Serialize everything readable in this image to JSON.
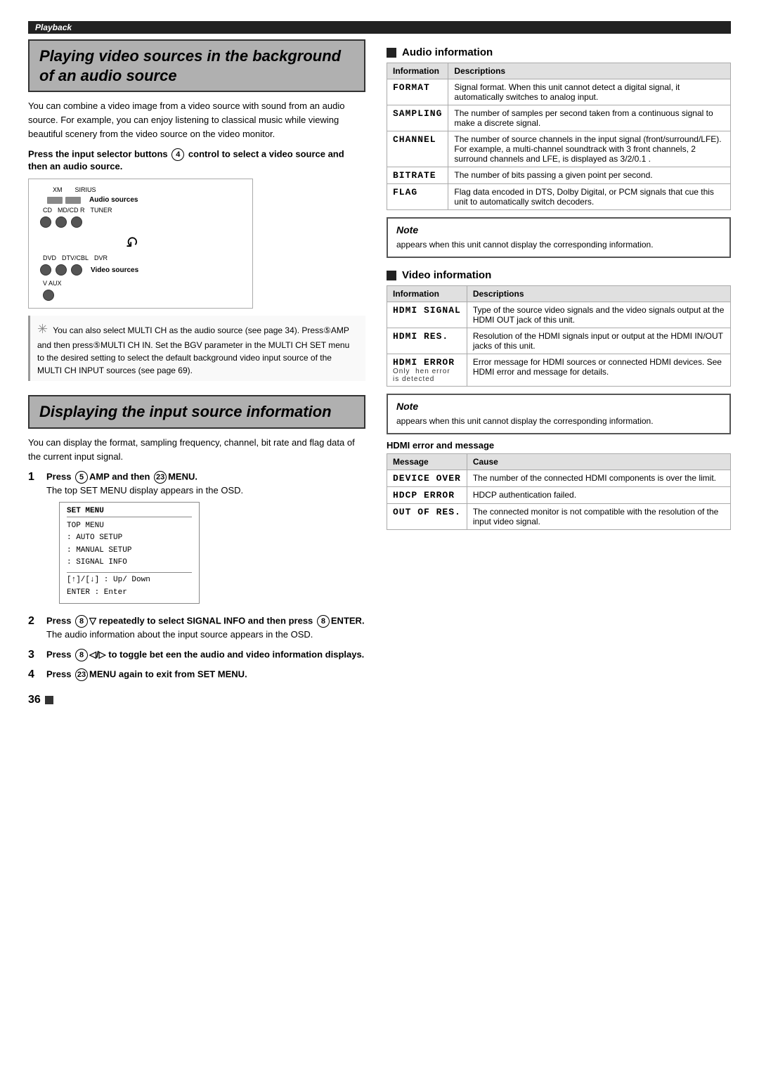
{
  "page": {
    "playback_label": "Playback",
    "page_number": "36"
  },
  "left": {
    "section1": {
      "title": "Playing video sources in the background of an audio source",
      "body": "You can combine a video image from a video source with sound from an audio source. For example, you can enjoy listening to classical music while viewing beautiful scenery from the video source on the video monitor.",
      "instruction_bold": "Press the input selector buttons",
      "circle4": "4",
      "instruction_rest": " control to select a video source and then an audio source.",
      "diagram": {
        "audio_label": "Audio sources",
        "video_label": "Video sources",
        "xm_label": "XM",
        "sirius_label": "SIRIUS",
        "cd_label": "CD",
        "mdcd_label": "MD/CD R",
        "tuner_label": "TUNER",
        "dvd_label": "DVD",
        "dtvcbl_label": "DTV/CBL",
        "dvr_label": "DVR",
        "vaux_label": "V AUX"
      },
      "tip": "You can also select MULTI CH as the audio source (see page 34). Press⑤AMP and then press⑤MULTI CH IN. Set the BGV parameter in the MULTI CH SET menu to the desired setting to select the default background video input source of the MULTI CH INPUT sources (see page 69)."
    },
    "section2": {
      "title": "Displaying the input source information",
      "body": "You can display the format, sampling frequency, channel, bit rate and flag data of the current input signal.",
      "steps": [
        {
          "num": "1",
          "bold": "Press ⑤AMP and then ㉓MENU.",
          "body": "The top SET MENU display appears in the OSD.",
          "osd": {
            "title": "SET MENU",
            "lines": [
              "TOP MENU",
              ": AUTO SETUP",
              ": MANUAL SETUP",
              ": SIGNAL INFO",
              "[↑]/[↓] : Up/ Down",
              "ENTER : Enter"
            ]
          }
        },
        {
          "num": "2",
          "bold": "Press ⑧▽ repeatedly to select SIGNAL INFO and then press ⑧ENTER.",
          "body": "The audio information about the input source appears in the OSD."
        },
        {
          "num": "3",
          "bold": "Press ⑧◁/▷ to toggle between the audio and video information displays."
        },
        {
          "num": "4",
          "bold": "Press ㉓MENU again to exit from SET MENU."
        }
      ]
    }
  },
  "right": {
    "audio_section": {
      "title": "Audio information",
      "table": {
        "headers": [
          "Information",
          "Descriptions"
        ],
        "rows": [
          {
            "info": "FORMAT",
            "desc": "Signal format. When this unit cannot detect a digital signal, it automatically switches to analog input."
          },
          {
            "info": "SAMPLING",
            "desc": "The number of samples per second taken from a continuous signal to make a discrete signal."
          },
          {
            "info": "CHANNEL",
            "desc": "The number of source channels in the input signal (front/surround/LFE). For example, a multi-channel soundtrack with 3 front channels, 2 surround channels and LFE, is displayed as 3/2/0.1 ."
          },
          {
            "info": "BITRATE",
            "desc": "The number of bits passing a given point per second."
          },
          {
            "info": "FLAG",
            "desc": "Flag data encoded in DTS, Dolby Digital, or PCM signals that cue this unit to automatically switch decoders."
          }
        ]
      }
    },
    "audio_note": {
      "title": "Note",
      "text": "appears when this unit cannot display the corresponding information."
    },
    "video_section": {
      "title": "Video information",
      "table": {
        "headers": [
          "Information",
          "Descriptions"
        ],
        "rows": [
          {
            "info": "HDMI SIGNAL",
            "desc": "Type of the source video signals and the video signals output at the HDMI OUT jack of this unit."
          },
          {
            "info": "HDMI RES.",
            "desc": "Resolution of the HDMI signals input or output at the HDMI IN/OUT jacks of this unit."
          },
          {
            "info": "HDMI ERROR",
            "desc": "Error message for HDMI sources or connected HDMI devices. See HDMI error and message for details.",
            "note": "Only  hen error\nis detected"
          }
        ]
      }
    },
    "video_note": {
      "title": "Note",
      "text": "appears when this unit cannot display the corresponding information."
    },
    "hdmi_error": {
      "title": "HDMI error and message",
      "table": {
        "headers": [
          "Message",
          "Cause"
        ],
        "rows": [
          {
            "msg": "DEVICE OVER",
            "cause": "The number of the connected HDMI components is over the limit."
          },
          {
            "msg": "HDCP ERROR",
            "cause": "HDCP authentication failed."
          },
          {
            "msg": "OUT OF RES.",
            "cause": "The connected monitor is not compatible with the resolution of the input video signal."
          }
        ]
      }
    }
  }
}
